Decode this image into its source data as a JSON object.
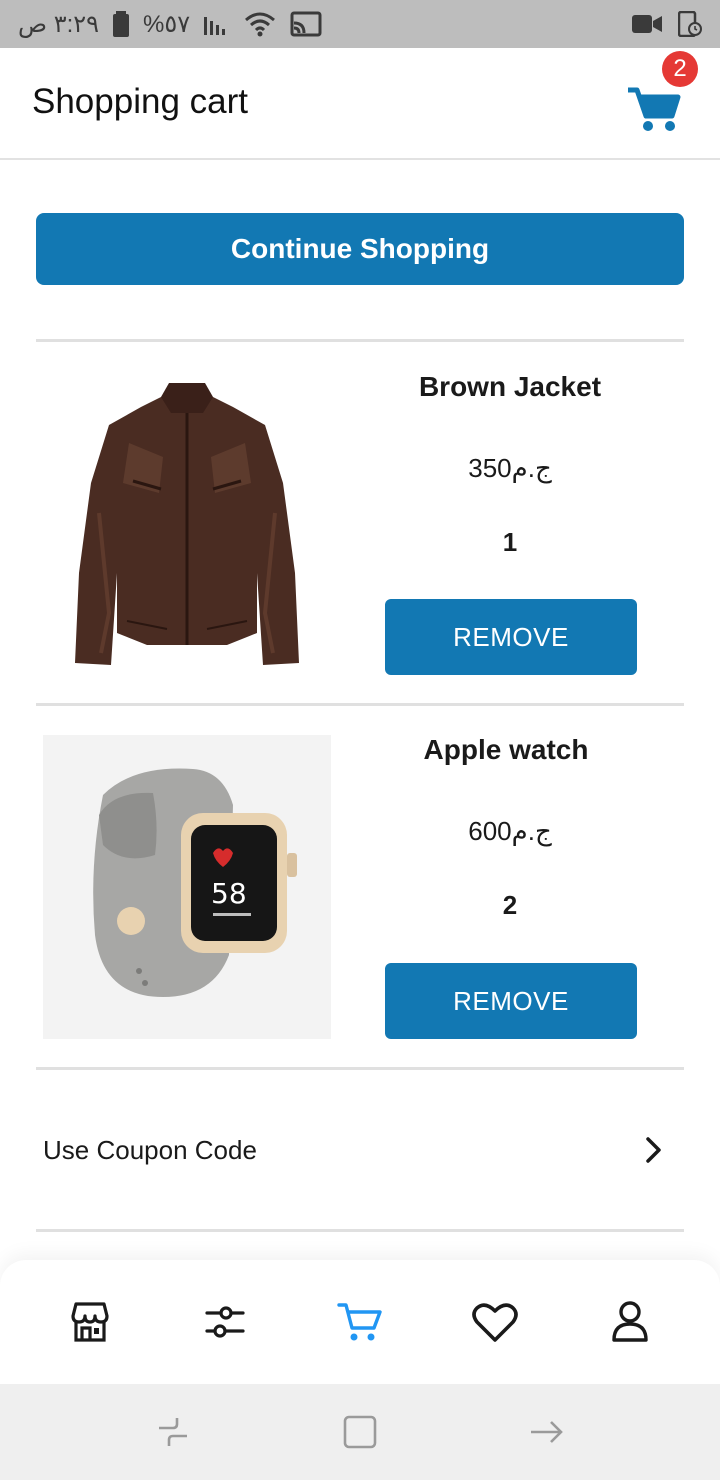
{
  "status_bar": {
    "time": "٣:٢٩ ص",
    "battery": "%٥٧",
    "icons": [
      "battery-icon",
      "signal-icon",
      "wifi-icon",
      "cast-icon",
      "video-camera-icon",
      "screen-recorder-icon"
    ]
  },
  "app_bar": {
    "title": "Shopping cart",
    "cart_badge_count": "2",
    "cart_icon": "cart-icon"
  },
  "colors": {
    "primary": "#1278b3",
    "badge": "#e53935",
    "active_nav": "#2196f3"
  },
  "continue_button": {
    "label": "Continue Shopping"
  },
  "cart_items": [
    {
      "name": "Brown Jacket",
      "price": "350ج.م",
      "quantity": "1",
      "remove_label": "REMOVE",
      "image": "brown-leather-jacket"
    },
    {
      "name": "Apple watch",
      "price": "600ج.م",
      "quantity": "2",
      "remove_label": "REMOVE",
      "image": "apple-watch-gray-band"
    }
  ],
  "coupon": {
    "label": "Use Coupon Code",
    "icon": "chevron-right-icon"
  },
  "bottom_nav": {
    "items": [
      {
        "icon": "store-icon",
        "active": false
      },
      {
        "icon": "filter-sliders-icon",
        "active": false
      },
      {
        "icon": "cart-icon",
        "active": true
      },
      {
        "icon": "heart-icon",
        "active": false
      },
      {
        "icon": "user-icon",
        "active": false
      }
    ]
  },
  "system_nav": {
    "icons": [
      "recent-apps-icon",
      "home-icon",
      "back-icon"
    ]
  }
}
